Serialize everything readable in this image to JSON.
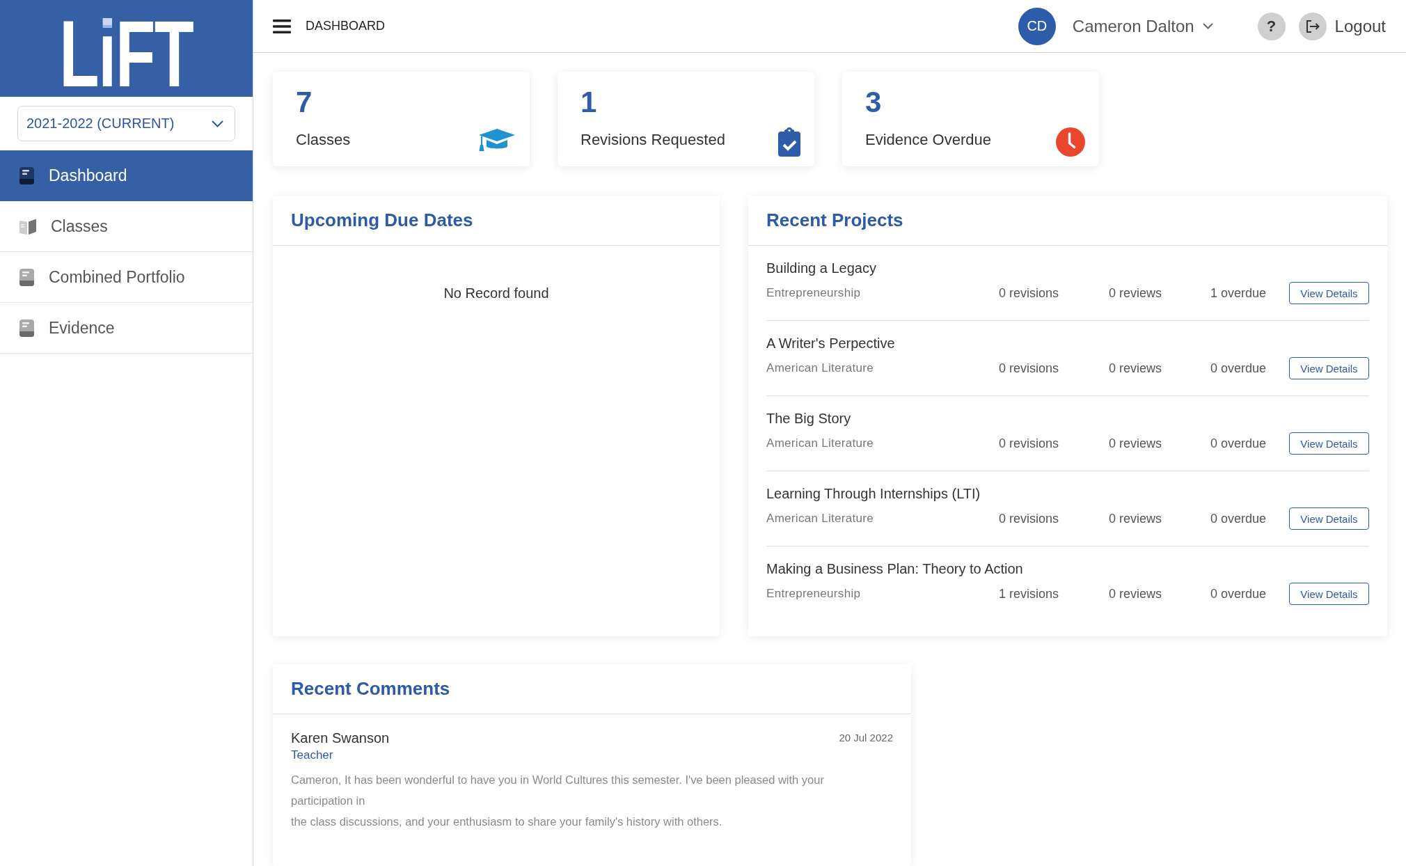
{
  "sidebar": {
    "logo": "LiFT",
    "year_select": {
      "value": "2021-2022 (CURRENT)"
    },
    "nav": [
      {
        "label": "Dashboard",
        "kind": "document",
        "selected": true
      },
      {
        "label": "Classes",
        "kind": "book",
        "selected": false
      },
      {
        "label": "Combined Portfolio",
        "kind": "document",
        "selected": false
      },
      {
        "label": "Evidence",
        "kind": "document",
        "selected": false
      }
    ]
  },
  "header": {
    "page_title": "DASHBOARD",
    "user": {
      "initials": "CD",
      "name": "Cameron Dalton"
    },
    "help": "?",
    "logout": "Logout"
  },
  "stats": [
    {
      "kind": "classes",
      "value": "7",
      "label": "Classes"
    },
    {
      "kind": "revisions",
      "value": "1",
      "label": "Revisions Requested"
    },
    {
      "kind": "overdue",
      "value": "3",
      "label": "Evidence Overdue"
    }
  ],
  "upcoming_due_dates": {
    "title": "Upcoming Due Dates",
    "empty_message": "No Record found"
  },
  "recent_projects": {
    "title": "Recent Projects",
    "rows": [
      {
        "title": "Building a Legacy",
        "class": "Entrepreneurship",
        "revisions": "0 revisions",
        "reviews": "0 reviews",
        "overdue": "1 overdue",
        "action": "View Details"
      },
      {
        "title": "A Writer's Perpective",
        "class": "American Literature",
        "revisions": "0 revisions",
        "reviews": "0 reviews",
        "overdue": "0 overdue",
        "action": "View Details"
      },
      {
        "title": "The Big Story",
        "class": "American Literature",
        "revisions": "0 revisions",
        "reviews": "0 reviews",
        "overdue": "0 overdue",
        "action": "View Details"
      },
      {
        "title": "Learning Through Internships (LTI)",
        "class": "American Literature",
        "revisions": "0 revisions",
        "reviews": "0 reviews",
        "overdue": "0 overdue",
        "action": "View Details"
      },
      {
        "title": "Making a Business Plan: Theory to Action",
        "class": "Entrepreneurship",
        "revisions": "1 revisions",
        "reviews": "0 reviews",
        "overdue": "0 overdue",
        "action": "View Details"
      }
    ]
  },
  "recent_comments": {
    "title": "Recent Comments",
    "items": [
      {
        "author": "Karen Swanson",
        "role": "Teacher",
        "date": "20 Jul 2022",
        "text": "Cameron, It has been wonderful to have you in World Cultures this semester. I've been pleased with your participation in\nthe class discussions, and your enthusiasm to share your family's history with others."
      }
    ]
  }
}
